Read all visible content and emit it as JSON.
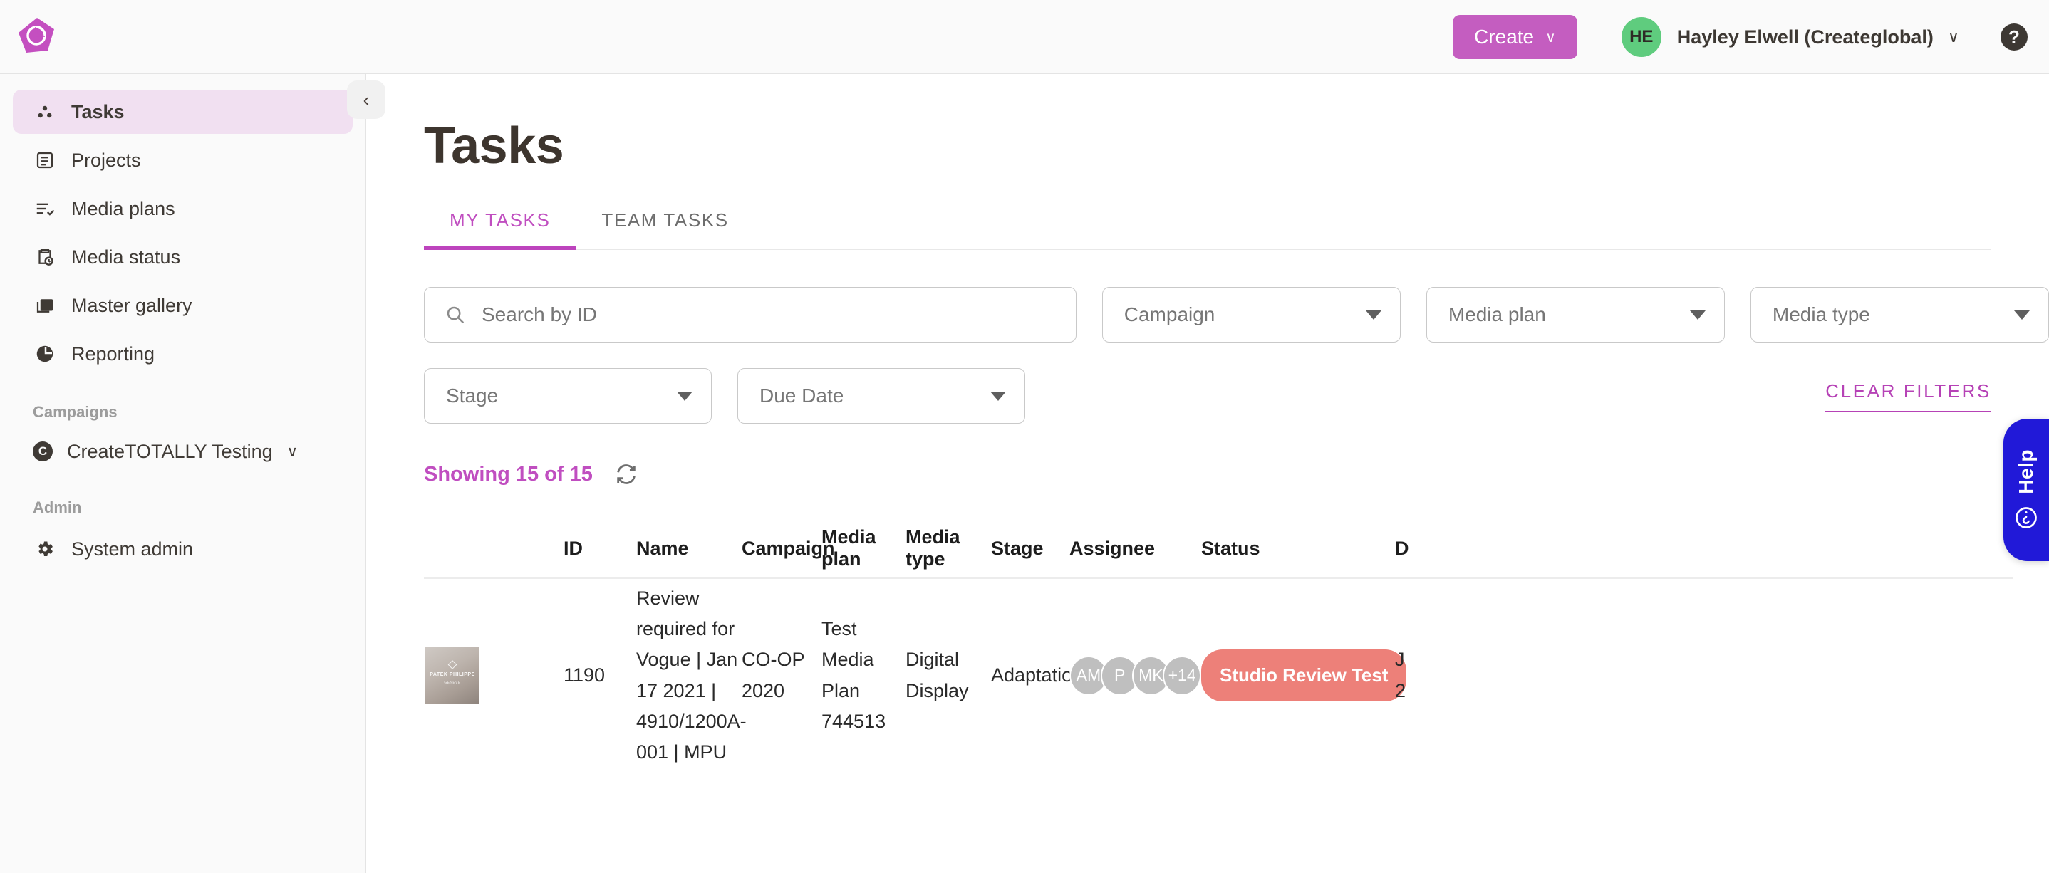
{
  "topbar": {
    "logo_icon": "createtotally-logo",
    "create_label": "Create",
    "create_caret": "∨",
    "avatar_initials": "HE",
    "user_name": "Hayley Elwell (Createglobal)",
    "user_caret": "∨",
    "help_glyph": "?",
    "accent_color": "#c45dc0",
    "avatar_color": "#5fcc7e"
  },
  "sidebar": {
    "collapse_glyph": "‹",
    "items": [
      {
        "label": "Tasks",
        "icon": "tasks-icon",
        "active": true
      },
      {
        "label": "Projects",
        "icon": "projects-icon",
        "active": false
      },
      {
        "label": "Media plans",
        "icon": "media-plans-icon",
        "active": false
      },
      {
        "label": "Media status",
        "icon": "media-status-icon",
        "active": false
      },
      {
        "label": "Master gallery",
        "icon": "master-gallery-icon",
        "active": false
      },
      {
        "label": "Reporting",
        "icon": "reporting-icon",
        "active": false
      }
    ],
    "campaigns_group_label": "Campaigns",
    "campaign": {
      "label": "CreateTOTALLY Testing",
      "badge": "C",
      "caret": "∨"
    },
    "admin_group_label": "Admin",
    "admin_item": {
      "label": "System admin",
      "icon": "gear-icon"
    },
    "active_bg": "#f1e0f1"
  },
  "main": {
    "page_title": "Tasks",
    "tabs": [
      {
        "label": "MY TASKS",
        "active": true
      },
      {
        "label": "TEAM TASKS",
        "active": false
      }
    ],
    "filters": {
      "search_placeholder": "Search by ID",
      "search_value": "",
      "search_icon": "search-icon",
      "campaign": {
        "label": "Campaign"
      },
      "media_plan": {
        "label": "Media plan"
      },
      "media_type": {
        "label": "Media type"
      },
      "stage": {
        "label": "Stage"
      },
      "due_date": {
        "label": "Due Date"
      },
      "clear_filters_label": "CLEAR FILTERS"
    },
    "showing_text": "Showing 15 of 15",
    "refresh_icon": "refresh-icon",
    "table": {
      "columns": [
        "",
        "ID",
        "Name",
        "Campaign",
        "Media plan",
        "Media type",
        "Stage",
        "Assignee",
        "Status",
        "D"
      ],
      "rows": [
        {
          "thumbnail": {
            "brand": "PATEK PHILIPPE",
            "sub": "GENEVE",
            "alt": "task-thumbnail"
          },
          "id": "1190",
          "name": "Review required for Vogue | Jan 17 2021 | 4910/1200A-001 | MPU",
          "campaign": "CO-OP 2020",
          "media_plan": "Test Media Plan 744513",
          "media_type": "Digital Display",
          "stage": "Adaptation",
          "assignees": [
            "AM",
            "P",
            "MK",
            "+14"
          ],
          "status": "Studio Review Test",
          "status_color": "#ed8079",
          "date_line1": "J",
          "date_line2": "2"
        }
      ]
    }
  },
  "help_widget": {
    "label": "Help",
    "icon": "question-circle-icon",
    "color": "#2119d8"
  }
}
